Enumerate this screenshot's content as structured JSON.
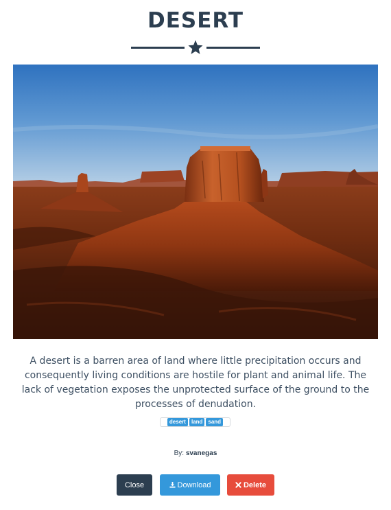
{
  "title": "DESERT",
  "photo": {
    "subject": "desert mesa landscape"
  },
  "description": "A desert is a barren area of land where little precipitation occurs and consequently living conditions are hostile for plant and animal life. The lack of vegetation exposes the unprotected surface of the ground to the processes of denudation.",
  "tags": [
    "desert",
    "land",
    "sand"
  ],
  "author": {
    "prefix": "By:",
    "name": "svanegas"
  },
  "buttons": {
    "close": "Close",
    "download": "Download",
    "delete": "Delete"
  },
  "colors": {
    "primary_text": "#2c3e50",
    "tag": "#3498db",
    "close": "#2c3e50",
    "download": "#3498db",
    "delete": "#e74c3c"
  },
  "icons": {
    "divider": "star-icon",
    "download": "download-icon",
    "delete": "times-icon"
  }
}
